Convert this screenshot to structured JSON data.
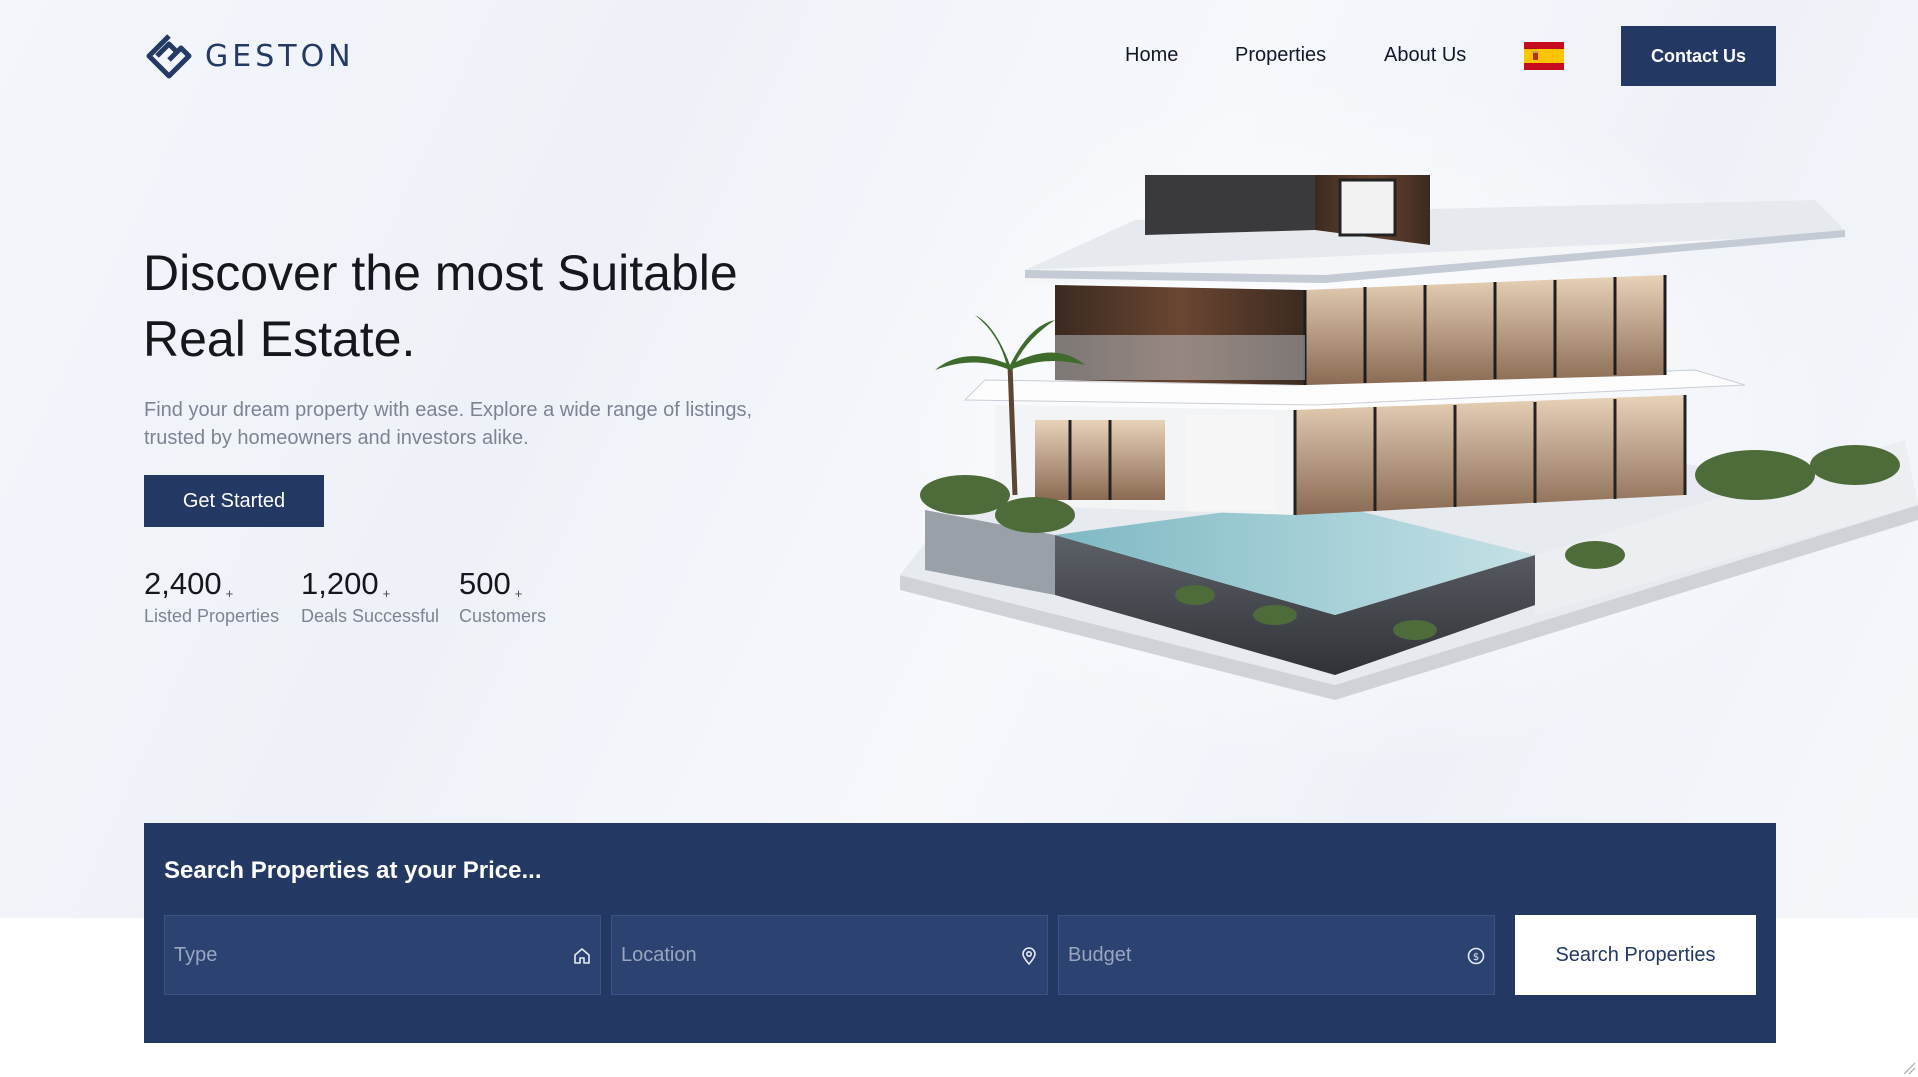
{
  "brand": {
    "name": "GESTON",
    "color": "#233862"
  },
  "nav": {
    "links": [
      "Home",
      "Properties",
      "About Us"
    ],
    "language_flag": "spain-flag-icon",
    "contact_label": "Contact Us"
  },
  "hero": {
    "title": "Discover the most Suitable Real Estate.",
    "subtitle": "Find your dream property with ease. Explore a wide range of listings, trusted by homeowners and investors alike.",
    "cta_label": "Get Started",
    "stats": [
      {
        "value": "2,400",
        "suffix": "+",
        "label": "Listed Properties"
      },
      {
        "value": "1,200",
        "suffix": "+",
        "label": "Deals Successful"
      },
      {
        "value": "500",
        "suffix": "+",
        "label": "Customers"
      }
    ],
    "image": "modern-villa-with-pool"
  },
  "search": {
    "title": "Search Properties at your Price...",
    "fields": [
      {
        "placeholder": "Type",
        "icon": "home-icon"
      },
      {
        "placeholder": "Location",
        "icon": "map-pin-icon"
      },
      {
        "placeholder": "Budget",
        "icon": "dollar-circle-icon"
      }
    ],
    "button_label": "Search Properties"
  }
}
